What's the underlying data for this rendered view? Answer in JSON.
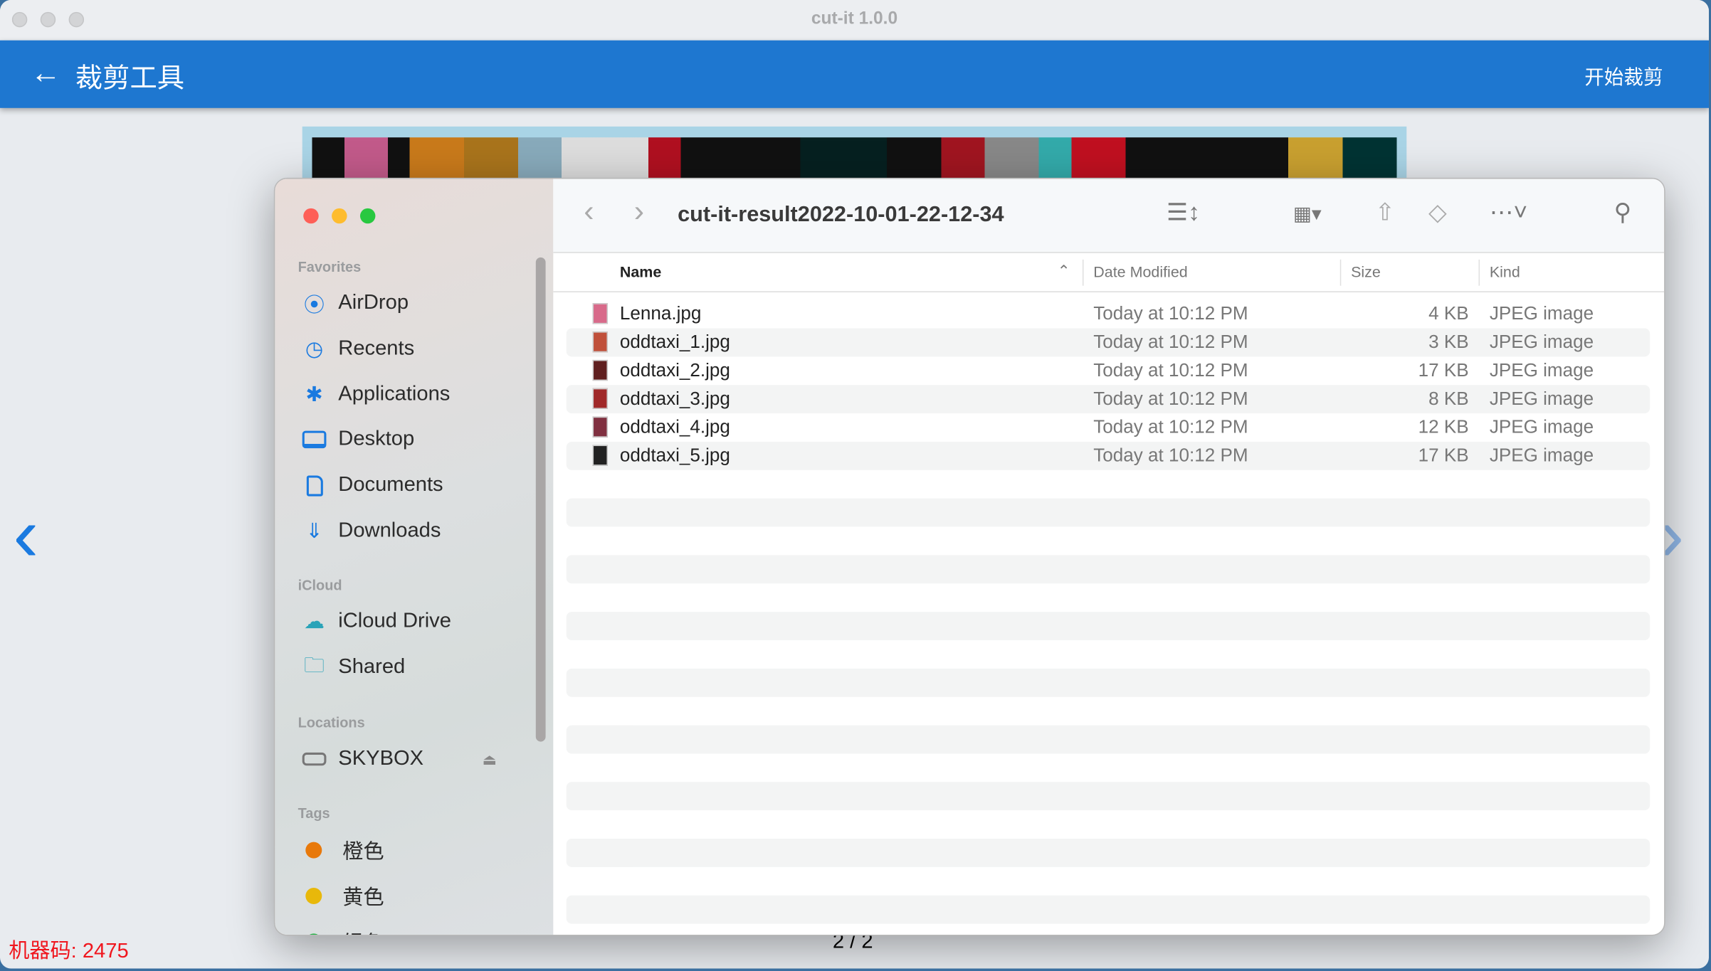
{
  "window": {
    "title": "cut-it 1.0.0"
  },
  "appbar": {
    "back_icon": "arrow-left-icon",
    "title": "裁剪工具",
    "start_label": "开始裁剪"
  },
  "nav": {
    "prev_icon": "chevron-left-icon",
    "next_icon": "chevron-right-icon"
  },
  "footer": {
    "machine_code": "机器码: 2475",
    "pager": "2 / 2"
  },
  "finder": {
    "folder": "cut-it-result2022-10-01-22-12-34",
    "sidebar": {
      "favorites_label": "Favorites",
      "favorites": [
        {
          "label": "AirDrop",
          "icon": "airdrop-icon"
        },
        {
          "label": "Recents",
          "icon": "clock-icon"
        },
        {
          "label": "Applications",
          "icon": "applications-icon"
        },
        {
          "label": "Desktop",
          "icon": "desktop-icon"
        },
        {
          "label": "Documents",
          "icon": "document-icon"
        },
        {
          "label": "Downloads",
          "icon": "download-icon"
        }
      ],
      "icloud_label": "iCloud",
      "icloud": [
        {
          "label": "iCloud Drive",
          "icon": "cloud-icon"
        },
        {
          "label": "Shared",
          "icon": "shared-folder-icon"
        }
      ],
      "locations_label": "Locations",
      "locations": [
        {
          "label": "SKYBOX",
          "icon": "drive-icon"
        }
      ],
      "tags_label": "Tags",
      "tags": [
        {
          "label": "橙色",
          "color": "#e8790b"
        },
        {
          "label": "黄色",
          "color": "#e8b80a"
        },
        {
          "label": "绿色",
          "color": "#2ab34a"
        }
      ]
    },
    "columns": {
      "name": "Name",
      "date": "Date Modified",
      "size": "Size",
      "kind": "Kind"
    },
    "files": [
      {
        "name": "Lenna.jpg",
        "date": "Today at 10:12 PM",
        "size": "4 KB",
        "kind": "JPEG image"
      },
      {
        "name": "oddtaxi_1.jpg",
        "date": "Today at 10:12 PM",
        "size": "3 KB",
        "kind": "JPEG image"
      },
      {
        "name": "oddtaxi_2.jpg",
        "date": "Today at 10:12 PM",
        "size": "17 KB",
        "kind": "JPEG image"
      },
      {
        "name": "oddtaxi_3.jpg",
        "date": "Today at 10:12 PM",
        "size": "8 KB",
        "kind": "JPEG image"
      },
      {
        "name": "oddtaxi_4.jpg",
        "date": "Today at 10:12 PM",
        "size": "12 KB",
        "kind": "JPEG image"
      },
      {
        "name": "oddtaxi_5.jpg",
        "date": "Today at 10:12 PM",
        "size": "17 KB",
        "kind": "JPEG image"
      }
    ]
  }
}
